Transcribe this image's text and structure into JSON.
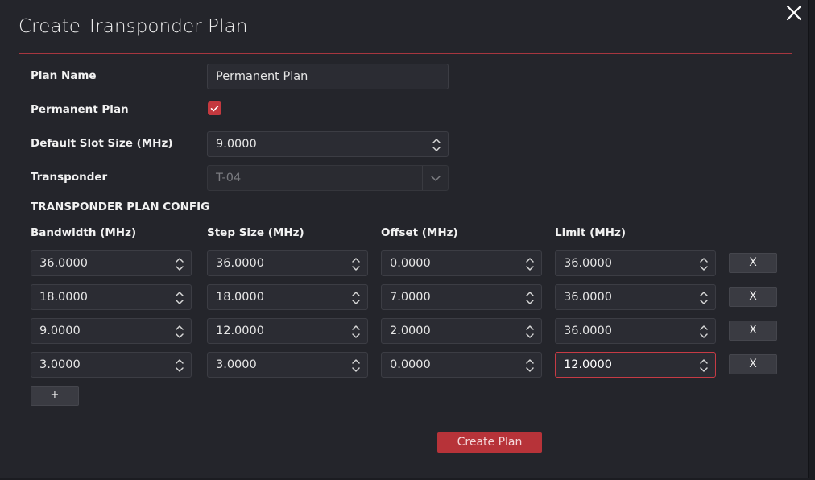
{
  "dialog": {
    "title": "Create Transponder Plan",
    "close_icon": "close-icon",
    "accent_color": "#c4393f"
  },
  "form": {
    "plan_name_label": "Plan Name",
    "plan_name_value": "Permanent Plan",
    "permanent_plan_label": "Permanent Plan",
    "permanent_plan_checked": true,
    "default_slot_size_label": "Default Slot Size (MHz)",
    "default_slot_size_value": "9.0000",
    "transponder_label": "Transponder",
    "transponder_value": "T-04"
  },
  "config": {
    "section_title": "TRANSPONDER PLAN CONFIG",
    "headers": {
      "bandwidth": "Bandwidth (MHz)",
      "step_size": "Step Size (MHz)",
      "offset": "Offset (MHz)",
      "limit": "Limit (MHz)"
    },
    "rows": [
      {
        "bandwidth": "36.0000",
        "step_size": "36.0000",
        "offset": "0.0000",
        "limit": "36.0000",
        "remove_label": "X"
      },
      {
        "bandwidth": "18.0000",
        "step_size": "18.0000",
        "offset": "7.0000",
        "limit": "36.0000",
        "remove_label": "X"
      },
      {
        "bandwidth": "9.0000",
        "step_size": "12.0000",
        "offset": "2.0000",
        "limit": "36.0000",
        "remove_label": "X"
      },
      {
        "bandwidth": "3.0000",
        "step_size": "3.0000",
        "offset": "0.0000",
        "limit": "12.0000",
        "remove_label": "X"
      }
    ],
    "add_label": "+"
  },
  "actions": {
    "create_label": "Create Plan"
  }
}
